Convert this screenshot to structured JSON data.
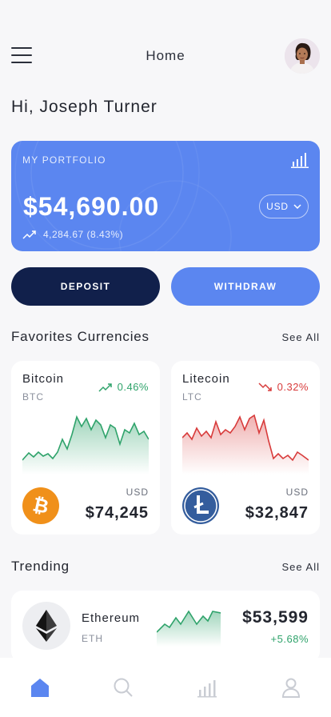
{
  "header": {
    "title": "Home",
    "menu_icon": "hamburger-menu-icon"
  },
  "greeting": "Hi, Joseph Turner",
  "portfolio": {
    "label": "MY PORTFOLIO",
    "amount": "$54,690.00",
    "change": "4,284.67 (8.43%)",
    "currency": "USD",
    "color": "#5b86f0"
  },
  "actions": {
    "deposit": "DEPOSIT",
    "withdraw": "WITHDRAW"
  },
  "favorites": {
    "title": "Favorites Currencies",
    "see_all": "See All",
    "items": [
      {
        "name": "Bitcoin",
        "symbol": "BTC",
        "change": "0.46%",
        "direction": "up",
        "currency": "USD",
        "price": "$74,245",
        "color": "#2fa36b",
        "logo_color": "#f0901a"
      },
      {
        "name": "Litecoin",
        "symbol": "LTC",
        "change": "0.32%",
        "direction": "down",
        "currency": "USD",
        "price": "$32,847",
        "color": "#d83b3b",
        "logo_color": "#345d9d"
      }
    ]
  },
  "trending": {
    "title": "Trending",
    "see_all": "See All",
    "items": [
      {
        "name": "Ethereum",
        "symbol": "ETH",
        "price": "$53,599",
        "change": "+5.68%",
        "color": "#2fa36b"
      }
    ]
  },
  "nav": {
    "items": [
      "home-icon",
      "search-icon",
      "stats-icon",
      "profile-icon"
    ],
    "active_color": "#5b86f0",
    "inactive_color": "#c9ccd3"
  }
}
